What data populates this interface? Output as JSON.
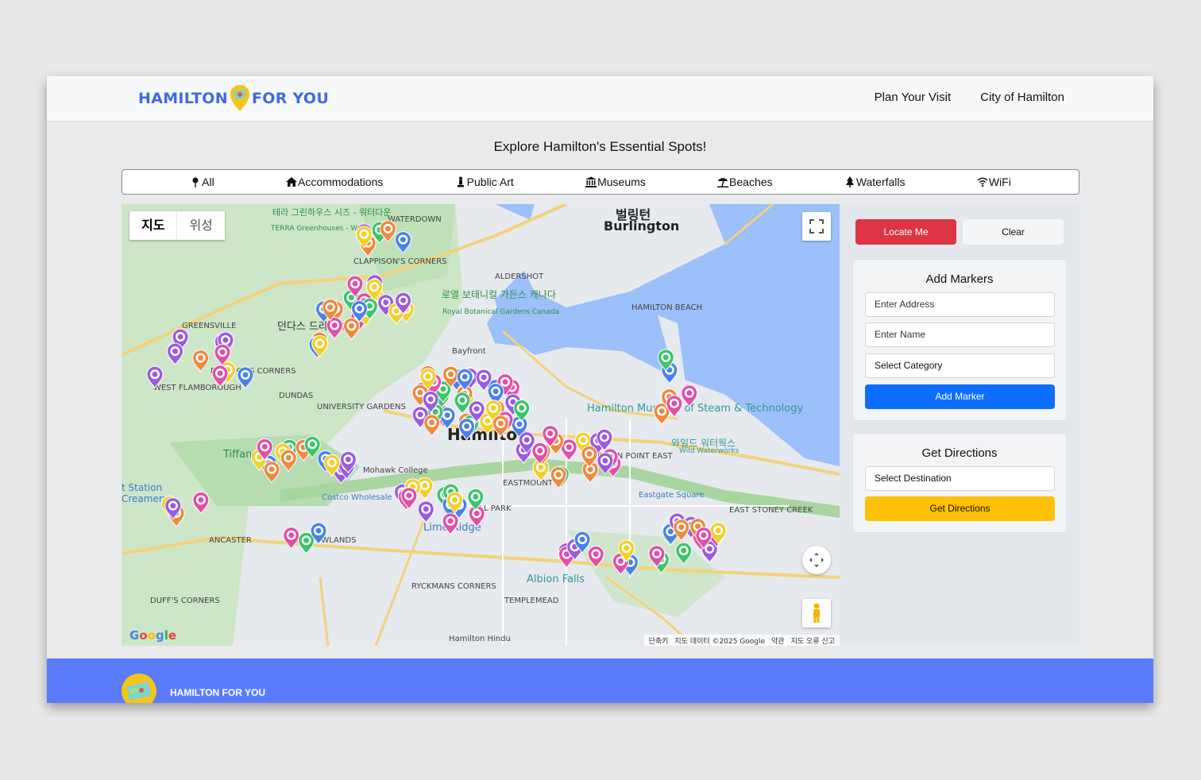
{
  "header": {
    "logo_left": "HAMILTON",
    "logo_right": "FOR YOU",
    "nav": [
      "Plan Your Visit",
      "City of Hamilton"
    ]
  },
  "page_title": "Explore Hamilton's Essential Spots!",
  "categories": [
    {
      "label": "All",
      "icon": "pin-icon"
    },
    {
      "label": "Accommodations",
      "icon": "house-icon"
    },
    {
      "label": "Public Art",
      "icon": "statue-icon"
    },
    {
      "label": "Museums",
      "icon": "museum-icon"
    },
    {
      "label": "Beaches",
      "icon": "umbrella-icon"
    },
    {
      "label": "Waterfalls",
      "icon": "waterfall-icon"
    },
    {
      "label": "WiFi",
      "icon": "wifi-icon"
    }
  ],
  "map": {
    "type_map": "지도",
    "type_satellite": "위성",
    "google": "Google",
    "attribution": [
      "단축키",
      "지도 데이터 ©2025 Google",
      "약관",
      "지도 오류 신고"
    ],
    "labels": {
      "burlington_ko": "벌링턴",
      "burlington": "Burlington",
      "hamilton": "Hamilton",
      "waterdown": "WATERDOWN",
      "terra_ko": "테라 그린하우스 시즈 - 워터다운",
      "terra": "TERRA Greenhouses - Waterdown",
      "clappison": "CLAPPISON'S CORNERS",
      "greensville": "GREENSVILLE",
      "dundas_ko": "던다스 드라이브",
      "dundas": "DUNDAS",
      "westflamborough": "WEST FLAMBOROUGH",
      "bullocks": "BULLOCK'S CORNERS",
      "aldershot": "ALDERSHOT",
      "botanical_ko": "로열 보태니컬 가든스 캐나다",
      "botanical": "Royal Botanical Gardens Canada",
      "bayfront": "Bayfront",
      "museum": "Hamilton Museum of Steam & Technology",
      "wildwaterworks_ko": "와일드 워터웍스",
      "wildwaterworks": "Wild Waterworks",
      "eastgate": "Eastgate Square",
      "stoneycreek": "EAST STONEY CREEK",
      "mohawk": "Mohawk College",
      "costco": "Costco Wholesale",
      "limeridge": "Lime Ridge",
      "albionfalls": "Albion Falls",
      "templemead": "TEMPLEMEAD",
      "ryckmans": "RYCKMANS CORNERS",
      "ancaster": "ANCASTER",
      "meadowlands": "MEADOWLANDS",
      "duffs": "DUFF'S CORNERS",
      "westation": "t Station Creamery",
      "crown": "CROWN POINT EAST",
      "eastmount": "EASTMOUNT",
      "hillpark": "HILL PARK",
      "hindu": "Hamilton Hindu",
      "univgardens": "UNIVERSITY GARDENS",
      "tiffany": "Tiffany",
      "hamiltonbeach": "HAMILTON BEACH"
    }
  },
  "side": {
    "locate": "Locate Me",
    "clear": "Clear",
    "add_title": "Add Markers",
    "address_placeholder": "Enter Address",
    "name_placeholder": "Enter Name",
    "category_select": "Select Category",
    "add_button": "Add Marker",
    "dir_title": "Get Directions",
    "destination_select": "Select Destination",
    "dir_button": "Get Directions"
  },
  "footer": {
    "text": "HAMILTON FOR YOU"
  },
  "colors": {
    "accent": "#3e6be0",
    "locate": "#dc3545",
    "add": "#0d6efd",
    "directions": "#ffc107",
    "footer": "#5a7cfc",
    "water": "#9cc0f9",
    "park": "#c5e5c3"
  }
}
